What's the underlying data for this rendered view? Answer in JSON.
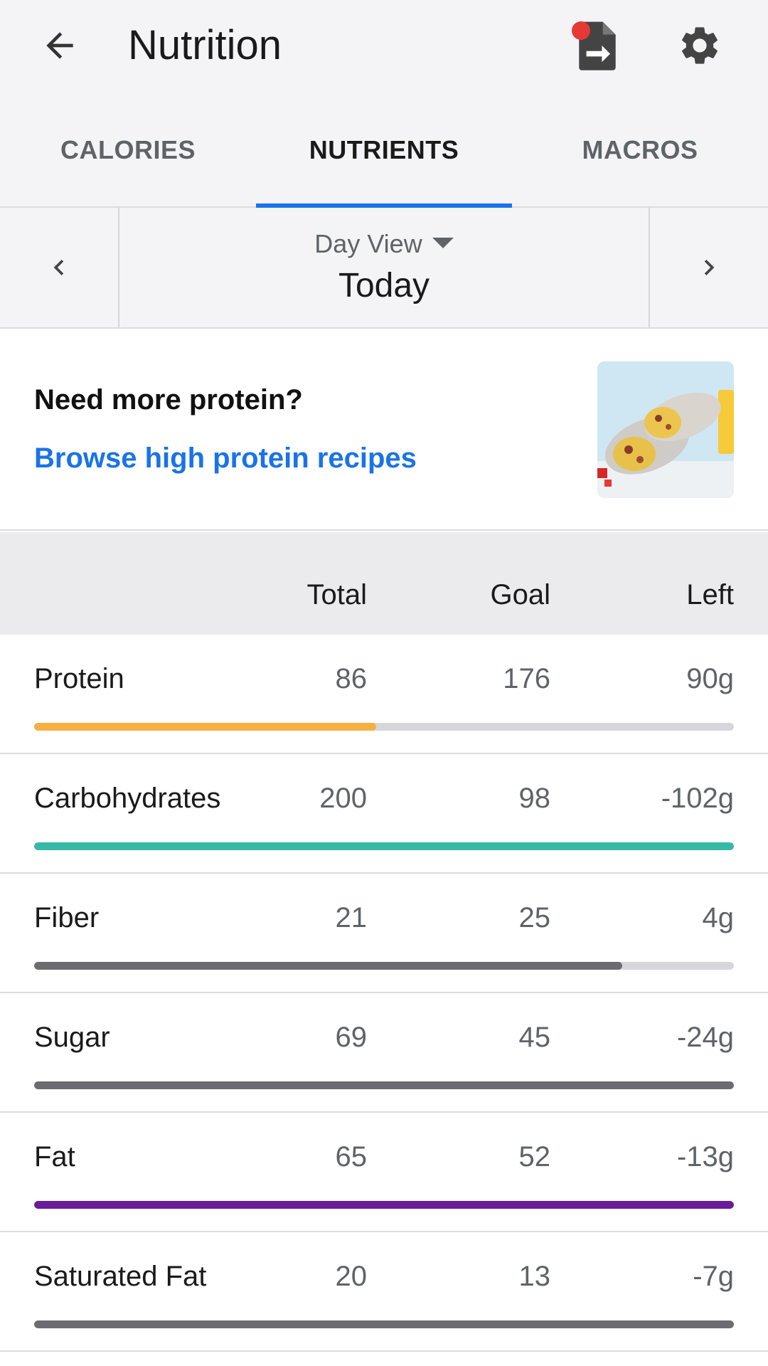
{
  "appbar": {
    "title": "Nutrition"
  },
  "tabs": [
    {
      "label": "CALORIES"
    },
    {
      "label": "NUTRIENTS"
    },
    {
      "label": "MACROS"
    }
  ],
  "datenav": {
    "view_label": "Day View",
    "date_label": "Today"
  },
  "promo": {
    "title": "Need more protein?",
    "link": "Browse high protein recipes"
  },
  "table": {
    "headers": {
      "total": "Total",
      "goal": "Goal",
      "left": "Left"
    },
    "rows": [
      {
        "name": "Protein",
        "total": "86",
        "goal": "176",
        "left": "90g",
        "progress": 0.489,
        "color": "#f6b042"
      },
      {
        "name": "Carbohydrates",
        "total": "200",
        "goal": "98",
        "left": "-102g",
        "progress": 1.0,
        "color": "#36b9a6"
      },
      {
        "name": "Fiber",
        "total": "21",
        "goal": "25",
        "left": "4g",
        "progress": 0.84,
        "color": "#6b6b70"
      },
      {
        "name": "Sugar",
        "total": "69",
        "goal": "45",
        "left": "-24g",
        "progress": 1.0,
        "color": "#6b6b70"
      },
      {
        "name": "Fat",
        "total": "65",
        "goal": "52",
        "left": "-13g",
        "progress": 1.0,
        "color": "#6a1b9a"
      },
      {
        "name": "Saturated Fat",
        "total": "20",
        "goal": "13",
        "left": "-7g",
        "progress": 1.0,
        "color": "#6b6b70"
      }
    ]
  },
  "icons": {
    "back": "arrow-back-icon",
    "export": "file-export-icon",
    "settings": "gear-icon",
    "prev": "chevron-left-icon",
    "next": "chevron-right-icon",
    "dropdown": "caret-down-icon"
  },
  "colors": {
    "accent": "#1a73e8",
    "notification": "#e53935"
  }
}
